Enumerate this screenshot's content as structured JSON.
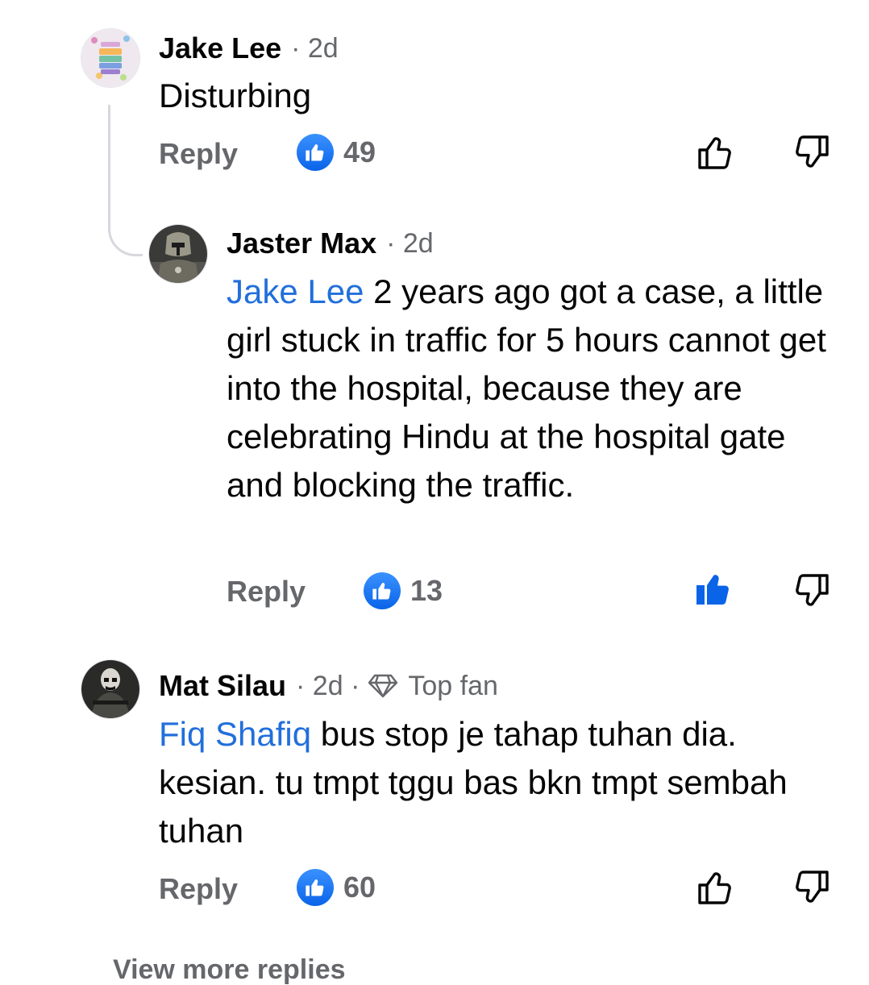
{
  "comments": [
    {
      "author": "Jake Lee",
      "time": "· 2d",
      "text": "Disturbing",
      "reply_label": "Reply",
      "like_count": "49"
    },
    {
      "author": "Jaster Max",
      "time": "· 2d",
      "mention": "Jake Lee",
      "text": " 2 years ago got a case, a little girl stuck in traffic for 5 hours cannot get into the hospital, because they are celebrating Hindu at the hospital gate and blocking the traffic.",
      "reply_label": "Reply",
      "like_count": "13",
      "liked": true
    },
    {
      "author": "Mat Silau",
      "time": "· 2d ·",
      "badge": "Top fan",
      "mention": "Fiq Shafiq",
      "text": " bus stop je tahap tuhan dia. kesian. tu tmpt tggu bas bkn tmpt sembah tuhan",
      "reply_label": "Reply",
      "like_count": "60"
    }
  ],
  "view_more": "View more replies",
  "colors": {
    "mention": "#216fdb",
    "like_blue": "#0a64e8",
    "muted": "#65676b",
    "text": "#050505"
  },
  "icons": [
    "like-badge-icon",
    "thumbs-up-outline-icon",
    "thumbs-up-filled-icon",
    "thumbs-down-outline-icon",
    "diamond-icon"
  ]
}
